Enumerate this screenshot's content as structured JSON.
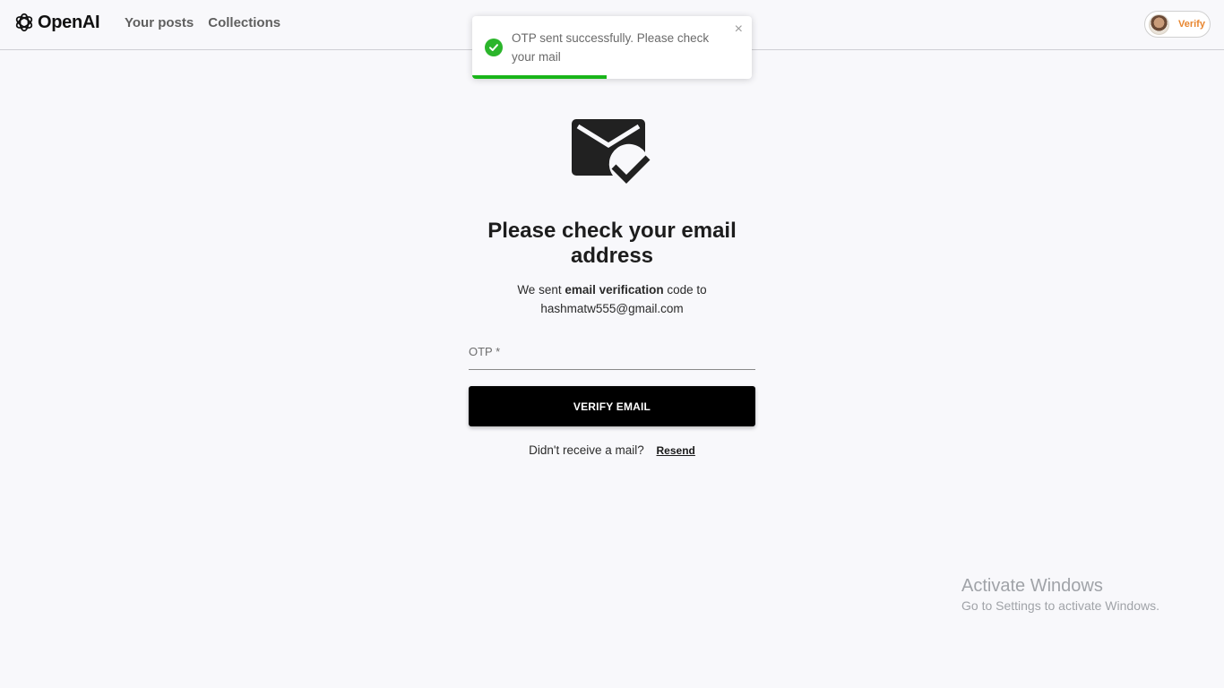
{
  "header": {
    "brand": "OpenAI",
    "nav": [
      "Your posts",
      "Collections"
    ],
    "profile_chip": "Verify"
  },
  "toast": {
    "message": "OTP sent successfully. Please check your mail",
    "close_glyph": "×",
    "progress_fraction": 0.48,
    "accent_color": "#19b519"
  },
  "main": {
    "title": "Please check your email address",
    "subtitle_prefix": "We sent ",
    "subtitle_bold": "email verification",
    "subtitle_suffix": " code to",
    "email": "hashmatw555@gmail.com",
    "otp_label": "OTP *",
    "verify_button": "VERIFY EMAIL",
    "resend_prompt": "Didn't receive a mail?",
    "resend_link": "Resend"
  },
  "watermark": {
    "title": "Activate Windows",
    "subtitle": "Go to Settings to activate Windows."
  }
}
